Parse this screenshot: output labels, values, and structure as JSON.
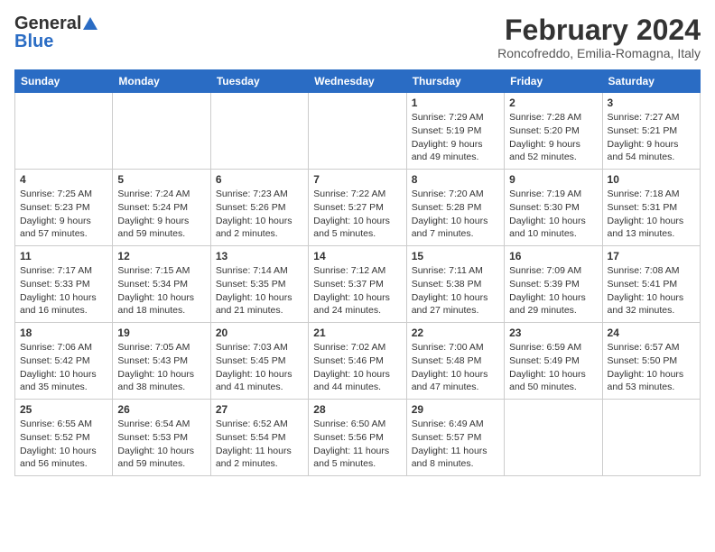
{
  "logo": {
    "general": "General",
    "blue": "Blue"
  },
  "title": "February 2024",
  "location": "Roncofreddo, Emilia-Romagna, Italy",
  "weekdays": [
    "Sunday",
    "Monday",
    "Tuesday",
    "Wednesday",
    "Thursday",
    "Friday",
    "Saturday"
  ],
  "weeks": [
    [
      {
        "day": "",
        "info": ""
      },
      {
        "day": "",
        "info": ""
      },
      {
        "day": "",
        "info": ""
      },
      {
        "day": "",
        "info": ""
      },
      {
        "day": "1",
        "info": "Sunrise: 7:29 AM\nSunset: 5:19 PM\nDaylight: 9 hours\nand 49 minutes."
      },
      {
        "day": "2",
        "info": "Sunrise: 7:28 AM\nSunset: 5:20 PM\nDaylight: 9 hours\nand 52 minutes."
      },
      {
        "day": "3",
        "info": "Sunrise: 7:27 AM\nSunset: 5:21 PM\nDaylight: 9 hours\nand 54 minutes."
      }
    ],
    [
      {
        "day": "4",
        "info": "Sunrise: 7:25 AM\nSunset: 5:23 PM\nDaylight: 9 hours\nand 57 minutes."
      },
      {
        "day": "5",
        "info": "Sunrise: 7:24 AM\nSunset: 5:24 PM\nDaylight: 9 hours\nand 59 minutes."
      },
      {
        "day": "6",
        "info": "Sunrise: 7:23 AM\nSunset: 5:26 PM\nDaylight: 10 hours\nand 2 minutes."
      },
      {
        "day": "7",
        "info": "Sunrise: 7:22 AM\nSunset: 5:27 PM\nDaylight: 10 hours\nand 5 minutes."
      },
      {
        "day": "8",
        "info": "Sunrise: 7:20 AM\nSunset: 5:28 PM\nDaylight: 10 hours\nand 7 minutes."
      },
      {
        "day": "9",
        "info": "Sunrise: 7:19 AM\nSunset: 5:30 PM\nDaylight: 10 hours\nand 10 minutes."
      },
      {
        "day": "10",
        "info": "Sunrise: 7:18 AM\nSunset: 5:31 PM\nDaylight: 10 hours\nand 13 minutes."
      }
    ],
    [
      {
        "day": "11",
        "info": "Sunrise: 7:17 AM\nSunset: 5:33 PM\nDaylight: 10 hours\nand 16 minutes."
      },
      {
        "day": "12",
        "info": "Sunrise: 7:15 AM\nSunset: 5:34 PM\nDaylight: 10 hours\nand 18 minutes."
      },
      {
        "day": "13",
        "info": "Sunrise: 7:14 AM\nSunset: 5:35 PM\nDaylight: 10 hours\nand 21 minutes."
      },
      {
        "day": "14",
        "info": "Sunrise: 7:12 AM\nSunset: 5:37 PM\nDaylight: 10 hours\nand 24 minutes."
      },
      {
        "day": "15",
        "info": "Sunrise: 7:11 AM\nSunset: 5:38 PM\nDaylight: 10 hours\nand 27 minutes."
      },
      {
        "day": "16",
        "info": "Sunrise: 7:09 AM\nSunset: 5:39 PM\nDaylight: 10 hours\nand 29 minutes."
      },
      {
        "day": "17",
        "info": "Sunrise: 7:08 AM\nSunset: 5:41 PM\nDaylight: 10 hours\nand 32 minutes."
      }
    ],
    [
      {
        "day": "18",
        "info": "Sunrise: 7:06 AM\nSunset: 5:42 PM\nDaylight: 10 hours\nand 35 minutes."
      },
      {
        "day": "19",
        "info": "Sunrise: 7:05 AM\nSunset: 5:43 PM\nDaylight: 10 hours\nand 38 minutes."
      },
      {
        "day": "20",
        "info": "Sunrise: 7:03 AM\nSunset: 5:45 PM\nDaylight: 10 hours\nand 41 minutes."
      },
      {
        "day": "21",
        "info": "Sunrise: 7:02 AM\nSunset: 5:46 PM\nDaylight: 10 hours\nand 44 minutes."
      },
      {
        "day": "22",
        "info": "Sunrise: 7:00 AM\nSunset: 5:48 PM\nDaylight: 10 hours\nand 47 minutes."
      },
      {
        "day": "23",
        "info": "Sunrise: 6:59 AM\nSunset: 5:49 PM\nDaylight: 10 hours\nand 50 minutes."
      },
      {
        "day": "24",
        "info": "Sunrise: 6:57 AM\nSunset: 5:50 PM\nDaylight: 10 hours\nand 53 minutes."
      }
    ],
    [
      {
        "day": "25",
        "info": "Sunrise: 6:55 AM\nSunset: 5:52 PM\nDaylight: 10 hours\nand 56 minutes."
      },
      {
        "day": "26",
        "info": "Sunrise: 6:54 AM\nSunset: 5:53 PM\nDaylight: 10 hours\nand 59 minutes."
      },
      {
        "day": "27",
        "info": "Sunrise: 6:52 AM\nSunset: 5:54 PM\nDaylight: 11 hours\nand 2 minutes."
      },
      {
        "day": "28",
        "info": "Sunrise: 6:50 AM\nSunset: 5:56 PM\nDaylight: 11 hours\nand 5 minutes."
      },
      {
        "day": "29",
        "info": "Sunrise: 6:49 AM\nSunset: 5:57 PM\nDaylight: 11 hours\nand 8 minutes."
      },
      {
        "day": "",
        "info": ""
      },
      {
        "day": "",
        "info": ""
      }
    ]
  ]
}
